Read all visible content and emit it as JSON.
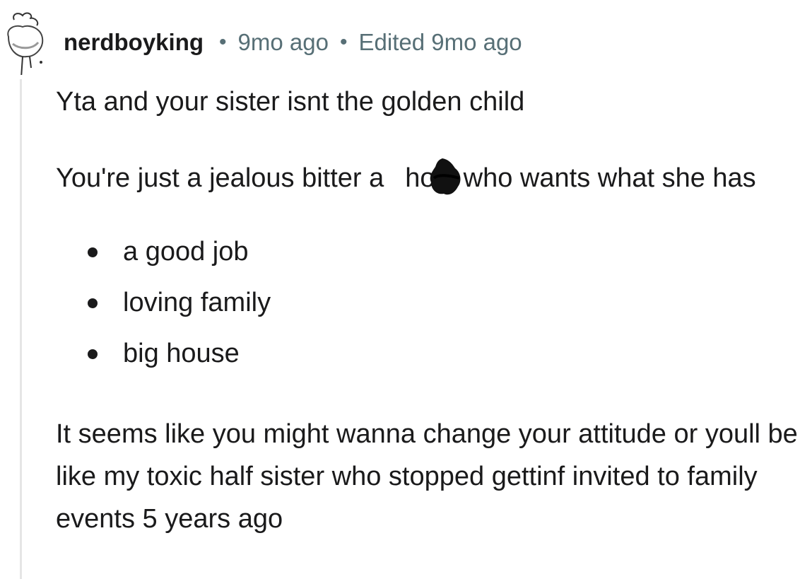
{
  "comment": {
    "username": "nerdboyking",
    "separator": "•",
    "posted_time": "9mo ago",
    "edited_label": "Edited 9mo ago",
    "paragraph_1": "Yta and your sister isnt the golden child",
    "paragraph_2_before_censor": "You're just a jealous bitter a",
    "paragraph_2_after_censor": "hole who wants what she has",
    "bullets": [
      "a good job",
      "loving family",
      "big house"
    ],
    "paragraph_3": "It seems like you might wanna change your attitude or youll be like my toxic half sister who stopped gettinf invited to family events 5 years ago"
  },
  "icons": {
    "avatar": "user-avatar-sketch-icon",
    "censor": "black-scribble-censor-icon"
  },
  "colors": {
    "text": "#1a1a1b",
    "muted": "#576f76",
    "thread_line": "#e5e5e5"
  }
}
